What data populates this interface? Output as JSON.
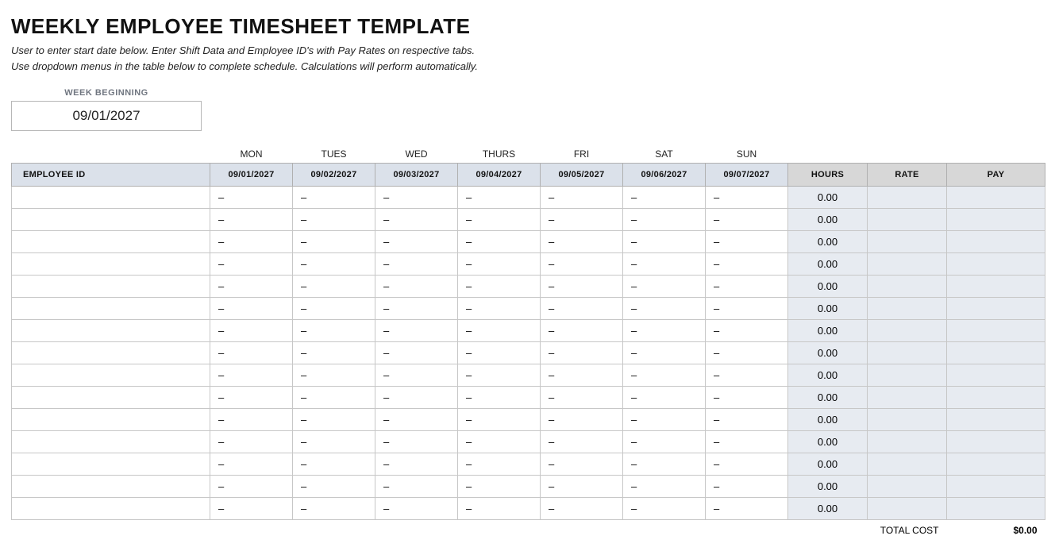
{
  "title": "WEEKLY EMPLOYEE TIMESHEET TEMPLATE",
  "subtitle_line1": "User to enter start date below.  Enter Shift Data and Employee ID's with Pay Rates on respective tabs.",
  "subtitle_line2": "Use dropdown menus in the table below to complete schedule. Calculations will perform automatically.",
  "week_label": "WEEK BEGINNING",
  "week_value": "09/01/2027",
  "day_names": [
    "MON",
    "TUES",
    "WED",
    "THURS",
    "FRI",
    "SAT",
    "SUN"
  ],
  "columns": {
    "employee": "EMPLOYEE ID",
    "dates": [
      "09/01/2027",
      "09/02/2027",
      "09/03/2027",
      "09/04/2027",
      "09/05/2027",
      "09/06/2027",
      "09/07/2027"
    ],
    "hours": "HOURS",
    "rate": "RATE",
    "pay": "PAY"
  },
  "rows": [
    {
      "employee": "",
      "days": [
        "–",
        "–",
        "–",
        "–",
        "–",
        "–",
        "–"
      ],
      "hours": "0.00",
      "rate": "",
      "pay": ""
    },
    {
      "employee": "",
      "days": [
        "–",
        "–",
        "–",
        "–",
        "–",
        "–",
        "–"
      ],
      "hours": "0.00",
      "rate": "",
      "pay": ""
    },
    {
      "employee": "",
      "days": [
        "–",
        "–",
        "–",
        "–",
        "–",
        "–",
        "–"
      ],
      "hours": "0.00",
      "rate": "",
      "pay": ""
    },
    {
      "employee": "",
      "days": [
        "–",
        "–",
        "–",
        "–",
        "–",
        "–",
        "–"
      ],
      "hours": "0.00",
      "rate": "",
      "pay": ""
    },
    {
      "employee": "",
      "days": [
        "–",
        "–",
        "–",
        "–",
        "–",
        "–",
        "–"
      ],
      "hours": "0.00",
      "rate": "",
      "pay": ""
    },
    {
      "employee": "",
      "days": [
        "–",
        "–",
        "–",
        "–",
        "–",
        "–",
        "–"
      ],
      "hours": "0.00",
      "rate": "",
      "pay": ""
    },
    {
      "employee": "",
      "days": [
        "–",
        "–",
        "–",
        "–",
        "–",
        "–",
        "–"
      ],
      "hours": "0.00",
      "rate": "",
      "pay": ""
    },
    {
      "employee": "",
      "days": [
        "–",
        "–",
        "–",
        "–",
        "–",
        "–",
        "–"
      ],
      "hours": "0.00",
      "rate": "",
      "pay": ""
    },
    {
      "employee": "",
      "days": [
        "–",
        "–",
        "–",
        "–",
        "–",
        "–",
        "–"
      ],
      "hours": "0.00",
      "rate": "",
      "pay": ""
    },
    {
      "employee": "",
      "days": [
        "–",
        "–",
        "–",
        "–",
        "–",
        "–",
        "–"
      ],
      "hours": "0.00",
      "rate": "",
      "pay": ""
    },
    {
      "employee": "",
      "days": [
        "–",
        "–",
        "–",
        "–",
        "–",
        "–",
        "–"
      ],
      "hours": "0.00",
      "rate": "",
      "pay": ""
    },
    {
      "employee": "",
      "days": [
        "–",
        "–",
        "–",
        "–",
        "–",
        "–",
        "–"
      ],
      "hours": "0.00",
      "rate": "",
      "pay": ""
    },
    {
      "employee": "",
      "days": [
        "–",
        "–",
        "–",
        "–",
        "–",
        "–",
        "–"
      ],
      "hours": "0.00",
      "rate": "",
      "pay": ""
    },
    {
      "employee": "",
      "days": [
        "–",
        "–",
        "–",
        "–",
        "–",
        "–",
        "–"
      ],
      "hours": "0.00",
      "rate": "",
      "pay": ""
    },
    {
      "employee": "",
      "days": [
        "–",
        "–",
        "–",
        "–",
        "–",
        "–",
        "–"
      ],
      "hours": "0.00",
      "rate": "",
      "pay": ""
    }
  ],
  "footer": {
    "total_label": "TOTAL COST",
    "total_value": "$0.00"
  }
}
